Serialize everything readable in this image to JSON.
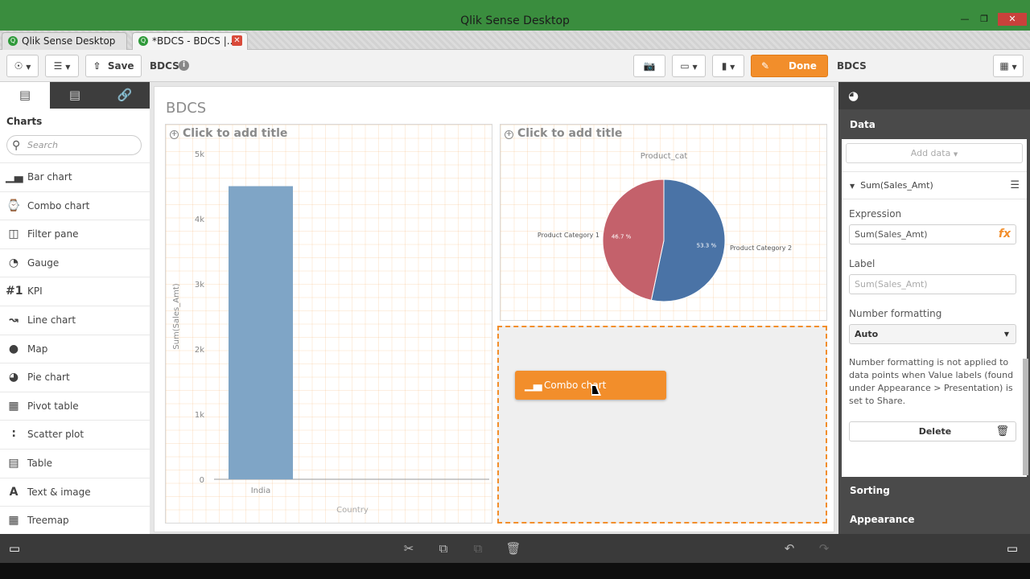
{
  "window": {
    "title": "Qlik Sense Desktop"
  },
  "browser_tabs": [
    {
      "label": "Qlik Sense Desktop hub"
    },
    {
      "label": "*BDCS - BDCS |..."
    }
  ],
  "toolbar": {
    "save_label": "Save",
    "app_name": "BDCS",
    "done_label": "Done",
    "sheet_name": "BDCS"
  },
  "left_panel": {
    "section_title": "Charts",
    "search_placeholder": "Search",
    "items": [
      {
        "label": "Bar chart",
        "icon": "bar-chart-icon"
      },
      {
        "label": "Combo chart",
        "icon": "combo-chart-icon"
      },
      {
        "label": "Filter pane",
        "icon": "filter-pane-icon"
      },
      {
        "label": "Gauge",
        "icon": "gauge-icon"
      },
      {
        "label": "KPI",
        "icon": "kpi-icon"
      },
      {
        "label": "Line chart",
        "icon": "line-chart-icon"
      },
      {
        "label": "Map",
        "icon": "map-icon"
      },
      {
        "label": "Pie chart",
        "icon": "pie-chart-icon"
      },
      {
        "label": "Pivot table",
        "icon": "pivot-table-icon"
      },
      {
        "label": "Scatter plot",
        "icon": "scatter-plot-icon"
      },
      {
        "label": "Table",
        "icon": "table-icon"
      },
      {
        "label": "Text & image",
        "icon": "text-image-icon"
      },
      {
        "label": "Treemap",
        "icon": "treemap-icon"
      }
    ]
  },
  "sheet": {
    "title": "BDCS",
    "bar_object": {
      "title": "Click to add title"
    },
    "pie_object": {
      "title": "Click to add title"
    },
    "drag_chip_label": "Combo chart"
  },
  "chart_data": [
    {
      "type": "bar",
      "categories": [
        "India"
      ],
      "values": [
        4500
      ],
      "xlabel": "Country",
      "ylabel": "Sum(Sales_Amt)",
      "ylim": [
        0,
        5000
      ],
      "yticks": [
        "0",
        "1k",
        "2k",
        "3k",
        "4k",
        "5k"
      ],
      "color": "#7fa5c6"
    },
    {
      "type": "pie",
      "title": "Product_cat",
      "slices": [
        {
          "label": "Product Category 1",
          "value": 46.7,
          "value_label": "46.7 %",
          "color": "#c4616b"
        },
        {
          "label": "Product Category 2",
          "value": 53.3,
          "value_label": "53.3 %",
          "color": "#4a73a6"
        }
      ]
    }
  ],
  "right_panel": {
    "data_header": "Data",
    "add_data_label": "Add data",
    "measure_label": "Sum(Sales_Amt)",
    "expression_label": "Expression",
    "expression_value": "Sum(Sales_Amt)",
    "label_label": "Label",
    "label_placeholder": "Sum(Sales_Amt)",
    "number_formatting_label": "Number formatting",
    "number_formatting_value": "Auto",
    "note": "Number formatting is not applied to data points when Value labels (found under Appearance > Presentation) is set to Share.",
    "delete_label": "Delete",
    "sorting_header": "Sorting",
    "appearance_header": "Appearance"
  }
}
